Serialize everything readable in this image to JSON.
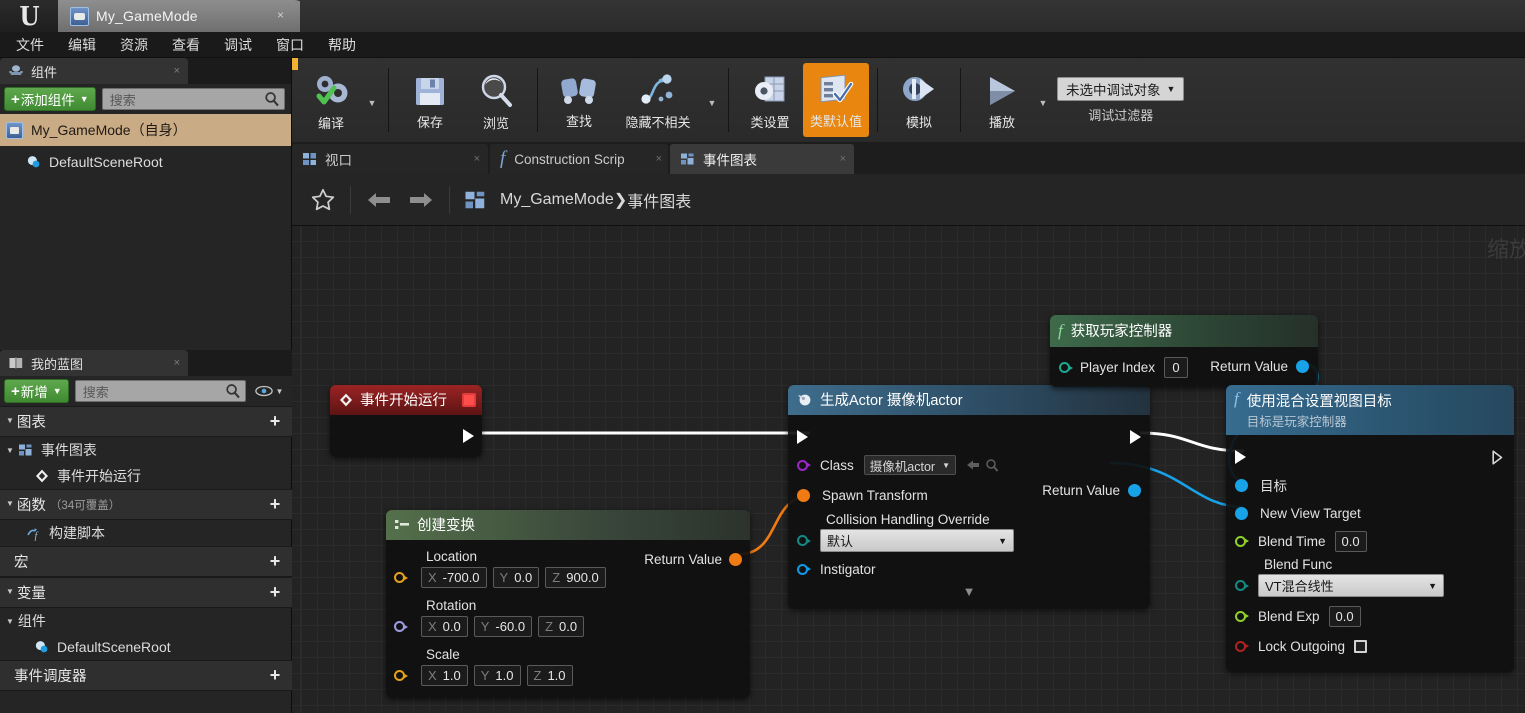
{
  "window": {
    "logo": "unreal-logo",
    "tab_title": "My_GameMode",
    "close_glyph": "×"
  },
  "menubar": {
    "items": [
      "文件",
      "编辑",
      "资源",
      "查看",
      "调试",
      "窗口",
      "帮助"
    ]
  },
  "toolbar": {
    "buttons": [
      {
        "label": "编译",
        "icon": "compile-icon",
        "has_caret": true,
        "highlight": false
      },
      {
        "label": "保存",
        "icon": "save-icon",
        "has_caret": false,
        "highlight": false
      },
      {
        "label": "浏览",
        "icon": "browse-icon",
        "has_caret": false,
        "highlight": false
      },
      {
        "label": "查找",
        "icon": "find-icon",
        "has_caret": false,
        "highlight": false
      },
      {
        "label": "隐藏不相关",
        "icon": "hide-unrelated-icon",
        "has_caret": true,
        "highlight": false
      },
      {
        "label": "类设置",
        "icon": "class-settings-icon",
        "has_caret": false,
        "highlight": false
      },
      {
        "label": "类默认值",
        "icon": "class-defaults-icon",
        "has_caret": false,
        "highlight": true
      },
      {
        "label": "模拟",
        "icon": "simulate-icon",
        "has_caret": false,
        "highlight": false
      },
      {
        "label": "播放",
        "icon": "play-icon",
        "has_caret": true,
        "highlight": false
      }
    ],
    "debug": {
      "value": "未选中调试对象",
      "caption": "调试过滤器"
    },
    "highlight_color": "#e8860f"
  },
  "components_panel": {
    "tab_label": "组件",
    "tab_icon": "components-icon",
    "close_glyph": "×",
    "add_button": "添加组件",
    "search_placeholder": "搜索",
    "tree": [
      {
        "label": "My_GameMode（自身）",
        "icon": "gamemode-icon",
        "selected": true,
        "indent": 0
      },
      {
        "label": "DefaultSceneRoot",
        "icon": "scene-root-icon",
        "selected": false,
        "indent": 1
      }
    ]
  },
  "myblueprint_panel": {
    "tab_label": "我的蓝图",
    "tab_icon": "blueprint-book-icon",
    "close_glyph": "×",
    "add_button": "新增",
    "search_placeholder": "搜索",
    "sections": [
      {
        "type": "header",
        "label": "图表",
        "sub": "",
        "expandable": true,
        "plus": true
      },
      {
        "type": "item",
        "label": "事件图表",
        "icon": "event-graph-icon",
        "indent": 0,
        "expandable": true
      },
      {
        "type": "item",
        "label": "事件开始运行",
        "icon": "event-node-icon",
        "indent": 1,
        "expandable": false
      },
      {
        "type": "header",
        "label": "函数",
        "sub": "（34可覆盖）",
        "expandable": true,
        "plus": true
      },
      {
        "type": "item",
        "label": "构建脚本",
        "icon": "function-icon",
        "indent": 0,
        "expandable": false
      },
      {
        "type": "header",
        "label": "宏",
        "sub": "",
        "expandable": false,
        "plus": true
      },
      {
        "type": "header",
        "label": "变量",
        "sub": "",
        "expandable": true,
        "plus": true
      },
      {
        "type": "item",
        "label": "组件",
        "icon": "",
        "indent": 0,
        "expandable": true
      },
      {
        "type": "item",
        "label": "DefaultSceneRoot",
        "icon": "scene-root-icon",
        "indent": 1,
        "expandable": false
      },
      {
        "type": "header",
        "label": "事件调度器",
        "sub": "",
        "expandable": false,
        "plus": true
      }
    ]
  },
  "document_tabs": [
    {
      "label": "视口",
      "icon": "viewport-icon",
      "active": false,
      "close_glyph": "×"
    },
    {
      "label": "Construction Scrip",
      "icon": "function-f-icon",
      "active": false,
      "close_glyph": "×"
    },
    {
      "label": "事件图表",
      "icon": "event-graph-icon",
      "active": true,
      "close_glyph": "×"
    }
  ],
  "breadcrumb": {
    "star_icon": "favorite-star-icon",
    "back_icon": "back-arrow-icon",
    "forward_icon": "forward-arrow-icon",
    "graph_icon": "event-graph-icon",
    "root": "My_GameMode",
    "separator": "❯",
    "leaf": "事件图表"
  },
  "graph": {
    "zoom_watermark": "缩放",
    "nodes": {
      "event_begin_play": {
        "title": "事件开始运行",
        "icon": "event-diamond-icon",
        "badge": "breakpoint-stop-icon",
        "header_color": "#8f1d1d"
      },
      "make_transform": {
        "title": "创建变换",
        "icon": "make-struct-icon",
        "header_color": "#45573f",
        "rows": [
          {
            "label": "Location",
            "pin_color": "#e5a219",
            "fields": [
              {
                "axis": "X",
                "value": "-700.0"
              },
              {
                "axis": "Y",
                "value": "0.0"
              },
              {
                "axis": "Z",
                "value": "900.0"
              }
            ]
          },
          {
            "label": "Rotation",
            "pin_color": "#9d9de2",
            "fields": [
              {
                "axis": "X",
                "value": "0.0"
              },
              {
                "axis": "Y",
                "value": "-60.0"
              },
              {
                "axis": "Z",
                "value": "0.0"
              }
            ]
          },
          {
            "label": "Scale",
            "pin_color": "#e5a219",
            "fields": [
              {
                "axis": "X",
                "value": "1.0"
              },
              {
                "axis": "Y",
                "value": "1.0"
              },
              {
                "axis": "Z",
                "value": "1.0"
              }
            ]
          }
        ],
        "return_label": "Return Value",
        "return_color": "#f07b12"
      },
      "spawn_actor": {
        "title": "生成Actor 摄像机actor",
        "icon": "spawn-actor-icon",
        "header_color": "#2c4a5e",
        "class_label": "Class",
        "class_value": "摄像机actor",
        "class_pin_color": "#9b27c9",
        "spawn_transform_label": "Spawn Transform",
        "spawn_transform_color": "#f07b12",
        "collision_label": "Collision Handling Override",
        "collision_value": "默认",
        "collision_pin_color": "#138a82",
        "instigator_label": "Instigator",
        "instigator_color": "#0f9ae8",
        "return_label": "Return Value",
        "return_color": "#18a2e8",
        "expand_glyph": "▼"
      },
      "get_player_controller": {
        "title": "获取玩家控制器",
        "icon": "function-f-icon",
        "header_color": "#2f4a36",
        "input_label": "Player Index",
        "input_value": "0",
        "input_pin_color": "#1da98e",
        "return_label": "Return Value",
        "return_color": "#18a2e8"
      },
      "set_view_target": {
        "title": "使用混合设置视图目标",
        "subtitle": "目标是玩家控制器",
        "icon": "function-f-icon",
        "header_color": "#2c5a78",
        "rows": [
          {
            "label": "目标",
            "pin": "dot",
            "color": "#18a2e8",
            "value": null
          },
          {
            "label": "New View Target",
            "pin": "dot",
            "color": "#18a2e8",
            "value": null
          },
          {
            "label": "Blend Time",
            "pin": "circle",
            "color": "#8fd12a",
            "value": "0.0"
          },
          {
            "label": "Blend Func",
            "pin": "circle",
            "color": "#138a82",
            "value": "VT混合线性",
            "widget": "combo"
          },
          {
            "label": "Blend Exp",
            "pin": "circle",
            "color": "#8fd12a",
            "value": "0.0"
          },
          {
            "label": "Lock Outgoing",
            "pin": "circle",
            "color": "#b02222",
            "value": "",
            "widget": "checkbox"
          }
        ]
      }
    }
  }
}
